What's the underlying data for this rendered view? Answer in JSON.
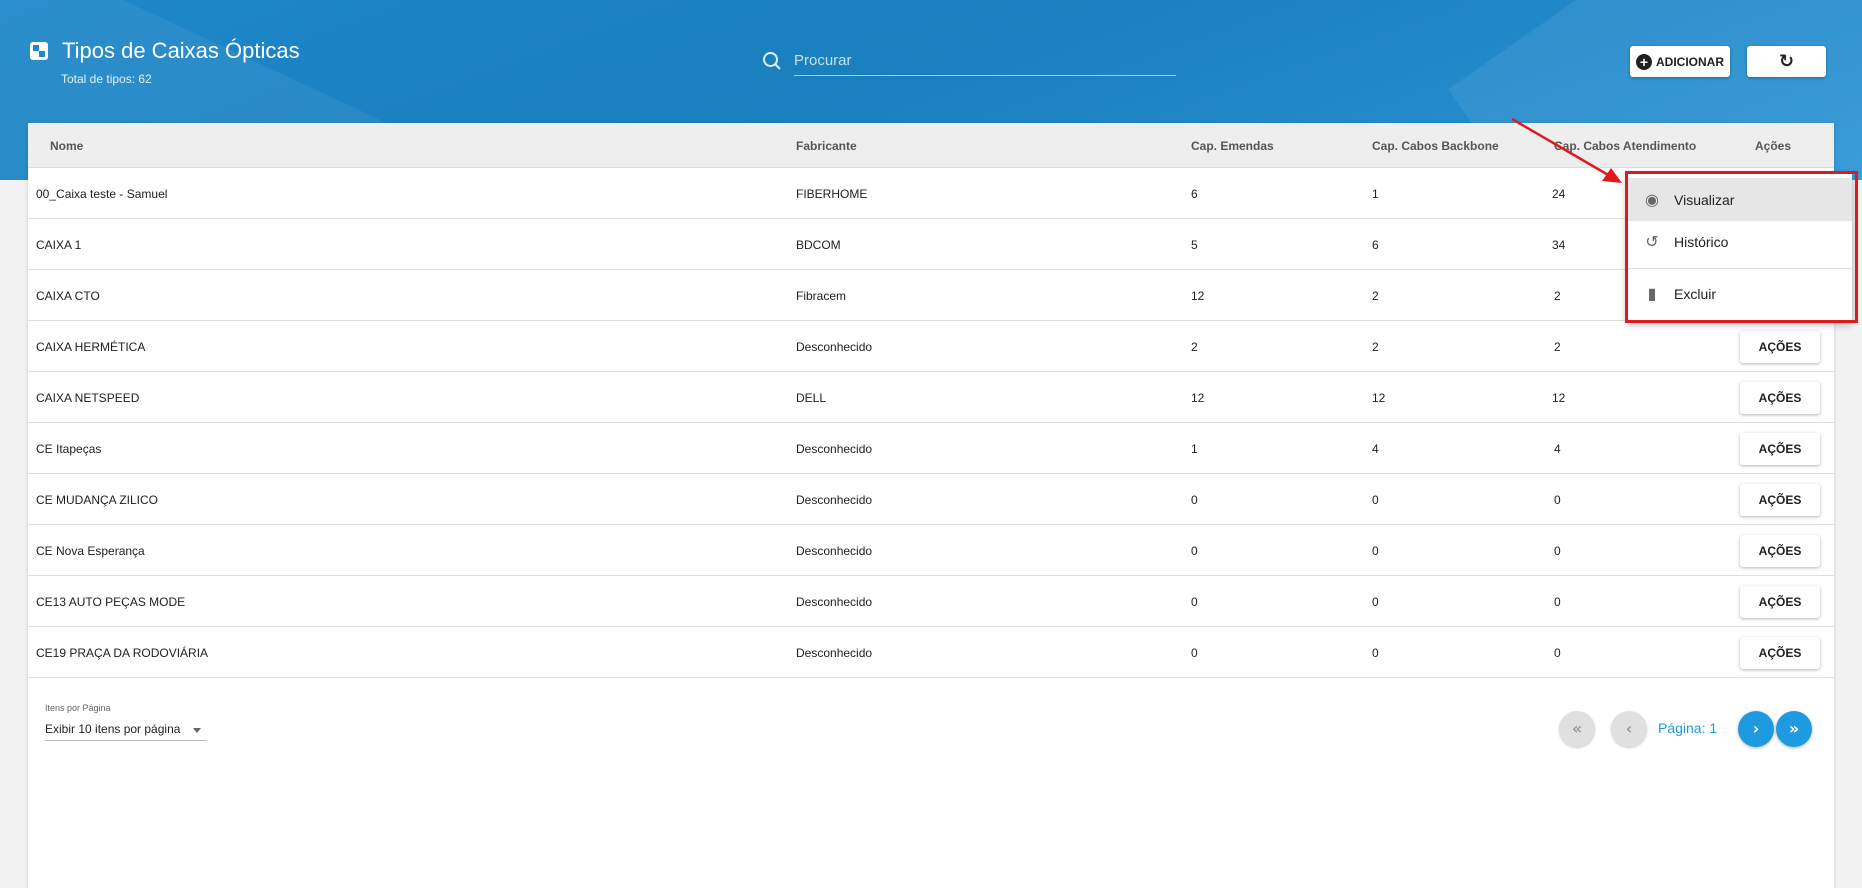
{
  "header": {
    "title": "Tipos de Caixas Ópticas",
    "subtitle": "Total de tipos: 62",
    "add_label": "ADICIONAR",
    "search_placeholder": "Procurar"
  },
  "table": {
    "columns": [
      "Nome",
      "Fabricante",
      "Cap. Emendas",
      "Cap. Cabos Backbone",
      "Cap. Cabos Atendimento",
      "Ações"
    ],
    "action_label": "AÇÕES",
    "rows": [
      {
        "nome": "00_Caixa teste - Samuel",
        "fabricante": "FIBERHOME",
        "emendas": "6",
        "backbone": "1",
        "atendimento": "24"
      },
      {
        "nome": "CAIXA 1",
        "fabricante": "BDCOM",
        "emendas": "5",
        "backbone": "6",
        "atendimento": "34"
      },
      {
        "nome": "CAIXA CTO",
        "fabricante": "Fibracem",
        "emendas": "12",
        "backbone": "2",
        "atendimento": "2"
      },
      {
        "nome": "CAIXA HERMÉTICA",
        "fabricante": "Desconhecido",
        "emendas": "2",
        "backbone": "2",
        "atendimento": "2"
      },
      {
        "nome": "CAIXA NETSPEED",
        "fabricante": "DELL",
        "emendas": "12",
        "backbone": "12",
        "atendimento": "12"
      },
      {
        "nome": "CE Itapeças",
        "fabricante": "Desconhecido",
        "emendas": "1",
        "backbone": "4",
        "atendimento": "4"
      },
      {
        "nome": "CE MUDANÇA ZILICO",
        "fabricante": "Desconhecido",
        "emendas": "0",
        "backbone": "0",
        "atendimento": "0"
      },
      {
        "nome": "CE Nova Esperança",
        "fabricante": "Desconhecido",
        "emendas": "0",
        "backbone": "0",
        "atendimento": "0"
      },
      {
        "nome": "CE13 AUTO PEÇAS MODE",
        "fabricante": "Desconhecido",
        "emendas": "0",
        "backbone": "0",
        "atendimento": "0"
      },
      {
        "nome": "CE19 PRAÇA DA RODOVIÁRIA",
        "fabricante": "Desconhecido",
        "emendas": "0",
        "backbone": "0",
        "atendimento": "0"
      }
    ]
  },
  "pagination": {
    "per_page_label": "Itens por Página",
    "per_page_value": "Exibir 10 itens por página",
    "page_label": "Página: 1"
  },
  "actions_menu": {
    "items": [
      {
        "label": "Visualizar",
        "icon": "eye-icon"
      },
      {
        "label": "Histórico",
        "icon": "history-icon"
      },
      {
        "label": "Excluir",
        "icon": "trash-icon"
      }
    ]
  },
  "annotation": {
    "color": "#e0191e"
  }
}
